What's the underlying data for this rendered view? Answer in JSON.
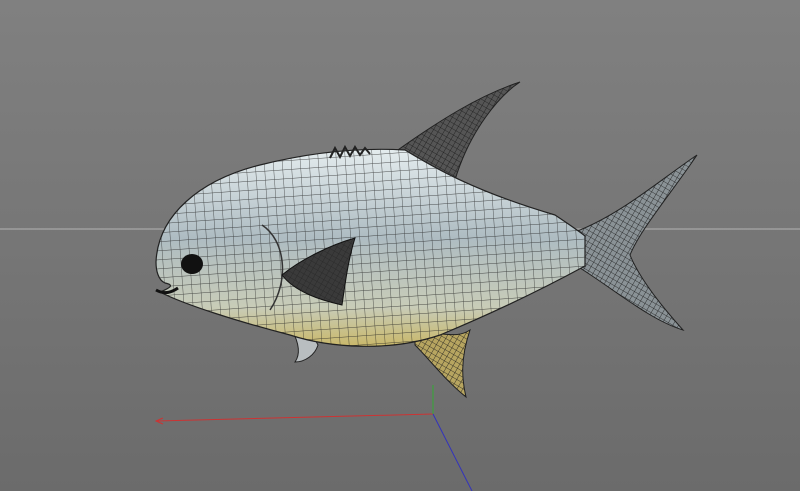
{
  "viewport": {
    "background": "#7a7a7a",
    "horizon_color": "#b4b4b4",
    "model_fill": "#c9d2d6",
    "wire_color": "#1e1e1e",
    "axes": {
      "x_color": "#cc3333",
      "y_color": "#33aa33",
      "z_color": "#3333bb"
    }
  }
}
